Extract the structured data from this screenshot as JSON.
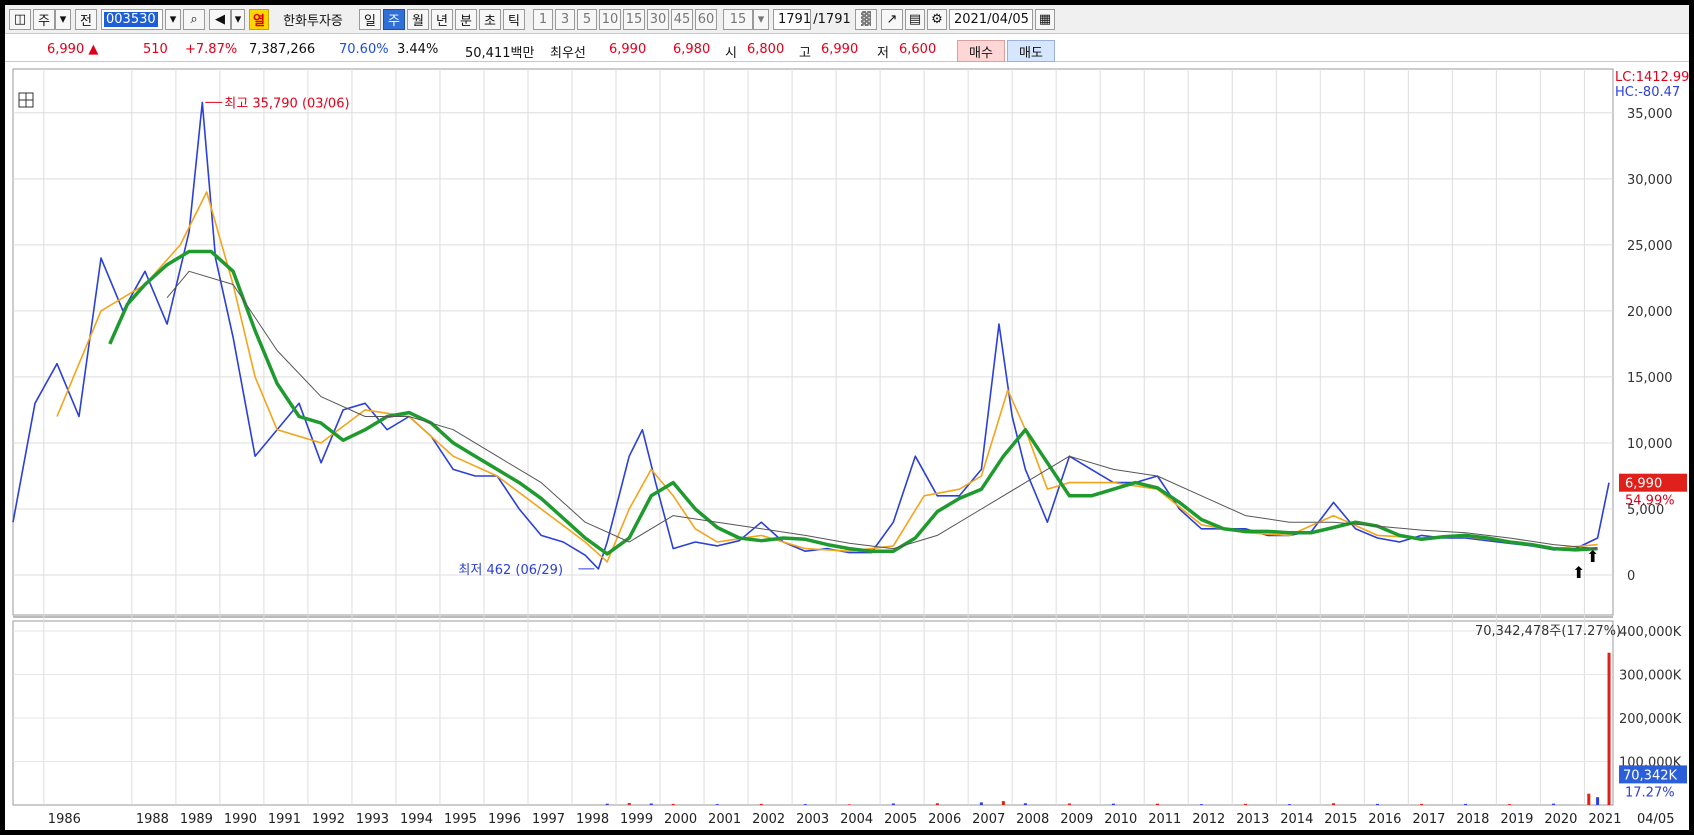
{
  "toolbar": {
    "type_label": "주",
    "prev_label": "전",
    "code_value": "003530",
    "broker_badge": "열",
    "broker_name": "한화투자증",
    "periods": [
      "일",
      "주",
      "월",
      "년",
      "분",
      "초",
      "틱"
    ],
    "active_period": "주",
    "intervals": [
      "1",
      "3",
      "5",
      "10",
      "15",
      "30",
      "45",
      "60"
    ],
    "interval_select": "15",
    "count": "1791",
    "total": "/1791",
    "date": "2021/04/05"
  },
  "quote": {
    "price": "6,990",
    "change": "510",
    "change_pct": "+7.87%",
    "volume": "7,387,266",
    "ratio1": "70.60%",
    "ratio2": "3.44%",
    "amount": "50,411백만",
    "pref_label": "최우선",
    "ask": "6,990",
    "bid": "6,980",
    "open_label": "시",
    "open": "6,800",
    "high_label": "고",
    "high": "6,990",
    "low_label": "저",
    "low": "6,600",
    "buy_label": "매수",
    "sell_label": "매도"
  },
  "chart_data": {
    "type": "line",
    "price_axis": {
      "ylim": [
        0,
        35790
      ],
      "ticks": [
        "0",
        "5,000",
        "10,000",
        "15,000",
        "20,000",
        "25,000",
        "30,000",
        "35,000"
      ],
      "tick_values": [
        0,
        5000,
        10000,
        15000,
        20000,
        25000,
        30000,
        35000
      ]
    },
    "volume_axis": {
      "ylim": [
        0,
        400000
      ],
      "ticks": [
        "100,000K",
        "200,000K",
        "300,000K",
        "400,000K"
      ],
      "tick_values": [
        100000,
        200000,
        300000,
        400000
      ]
    },
    "x_labels": [
      "1986",
      "1988",
      "1989",
      "1990",
      "1991",
      "1992",
      "1993",
      "1994",
      "1995",
      "1996",
      "1997",
      "1998",
      "1999",
      "2000",
      "2001",
      "2002",
      "2003",
      "2004",
      "2005",
      "2006",
      "2007",
      "2008",
      "2009",
      "2010",
      "2011",
      "2012",
      "2013",
      "2014",
      "2015",
      "2016",
      "2017",
      "2018",
      "2019",
      "2020",
      "2021"
    ],
    "x_end_label": "04/05",
    "lc_label": "LC:1412.99",
    "hc_label": "HC:-80.47",
    "last_price_label": "6,990",
    "last_pct_label": "54.99%",
    "volume_tag": "70,342K",
    "volume_pct_tag": "17.27%",
    "volume_note": "70,342,478주(17.27%)",
    "high_annotation": "최고 35,790 (03/06)",
    "low_annotation": "최저 462 (06/29)",
    "series": [
      {
        "color": "#2b3fd9",
        "x": [
          1985.0,
          1985.5,
          1986.0,
          1986.5,
          1987.0,
          1987.5,
          1988.0,
          1988.5,
          1989.0,
          1989.3,
          1989.6,
          1990.0,
          1990.5,
          1991.0,
          1991.5,
          1992.0,
          1992.5,
          1993.0,
          1993.5,
          1994.0,
          1994.5,
          1995.0,
          1995.5,
          1996.0,
          1996.5,
          1997.0,
          1997.5,
          1998.0,
          1998.3,
          1998.5,
          1999.0,
          1999.3,
          1999.6,
          2000.0,
          2000.5,
          2001.0,
          2001.5,
          2002.0,
          2002.5,
          2003.0,
          2003.5,
          2004.0,
          2004.5,
          2005.0,
          2005.5,
          2006.0,
          2006.5,
          2007.0,
          2007.4,
          2007.7,
          2008.0,
          2008.5,
          2009.0,
          2009.5,
          2010.0,
          2010.5,
          2011.0,
          2011.5,
          2012.0,
          2012.5,
          2013.0,
          2013.5,
          2014.0,
          2014.5,
          2015.0,
          2015.5,
          2016.0,
          2016.5,
          2017.0,
          2017.5,
          2018.0,
          2018.5,
          2019.0,
          2019.5,
          2020.0,
          2020.5,
          2021.0,
          2021.26
        ],
        "y": [
          4000,
          13000,
          16000,
          12000,
          24000,
          20000,
          23000,
          19000,
          26000,
          35790,
          24000,
          18000,
          9000,
          11000,
          13000,
          8500,
          12500,
          13000,
          11000,
          12000,
          10500,
          8000,
          7500,
          7500,
          5000,
          3000,
          2500,
          1500,
          462,
          2500,
          9000,
          11000,
          7000,
          2000,
          2500,
          2200,
          2600,
          4000,
          2500,
          1800,
          2000,
          1700,
          1700,
          4000,
          9000,
          6000,
          6000,
          8000,
          19000,
          12000,
          8000,
          4000,
          9000,
          8000,
          7000,
          7000,
          7500,
          5000,
          3500,
          3500,
          3500,
          3000,
          3000,
          3300,
          5500,
          3500,
          2800,
          2500,
          3000,
          2800,
          2800,
          2600,
          2400,
          2200,
          1900,
          2000,
          2800,
          6990
        ]
      },
      {
        "color": "#f2a51b",
        "x": [
          1986.0,
          1987.0,
          1988.0,
          1988.8,
          1989.4,
          1990.0,
          1990.5,
          1991.0,
          1992.0,
          1993.0,
          1994.0,
          1995.0,
          1996.0,
          1997.0,
          1998.0,
          1998.5,
          1999.0,
          1999.5,
          2000.0,
          2000.5,
          2001.0,
          2002.0,
          2003.0,
          2004.0,
          2005.0,
          2005.7,
          2006.5,
          2007.0,
          2007.6,
          2008.0,
          2008.5,
          2009.0,
          2010.0,
          2011.0,
          2012.0,
          2013.0,
          2014.0,
          2015.0,
          2016.0,
          2017.0,
          2018.0,
          2019.0,
          2020.0,
          2021.0
        ],
        "y": [
          12000,
          20000,
          22000,
          25000,
          29000,
          22000,
          15000,
          11000,
          10000,
          12500,
          12000,
          9000,
          7500,
          5000,
          2500,
          1000,
          5000,
          8000,
          6000,
          3500,
          2500,
          3000,
          2000,
          1800,
          2200,
          6000,
          6500,
          7500,
          14000,
          11000,
          6500,
          7000,
          7000,
          6500,
          3800,
          3200,
          3000,
          4500,
          3000,
          2800,
          2900,
          2500,
          2000,
          2300
        ]
      },
      {
        "color": "#1f9a2e",
        "x": [
          1987.2,
          1987.6,
          1988.0,
          1988.5,
          1989.0,
          1989.5,
          1990.0,
          1990.5,
          1991.0,
          1991.5,
          1992.0,
          1992.5,
          1993.0,
          1993.5,
          1994.0,
          1994.5,
          1995.0,
          1995.5,
          1996.0,
          1996.5,
          1997.0,
          1997.5,
          1998.0,
          1998.5,
          1999.0,
          1999.5,
          2000.0,
          2000.5,
          2001.0,
          2001.5,
          2002.0,
          2002.5,
          2003.0,
          2003.5,
          2004.0,
          2004.5,
          2005.0,
          2005.5,
          2006.0,
          2006.5,
          2007.0,
          2007.5,
          2008.0,
          2008.5,
          2009.0,
          2009.5,
          2010.0,
          2010.5,
          2011.0,
          2011.5,
          2012.0,
          2012.5,
          2013.0,
          2013.5,
          2014.0,
          2014.5,
          2015.0,
          2015.5,
          2016.0,
          2016.5,
          2017.0,
          2017.5,
          2018.0,
          2018.5,
          2019.0,
          2019.5,
          2020.0,
          2020.5,
          2021.0
        ],
        "y": [
          17500,
          20500,
          22000,
          23500,
          24500,
          24500,
          23000,
          18500,
          14500,
          12000,
          11500,
          10200,
          11000,
          12000,
          12300,
          11500,
          10000,
          9000,
          8000,
          7000,
          5800,
          4300,
          2800,
          1600,
          2800,
          6000,
          7000,
          5000,
          3600,
          2800,
          2600,
          2800,
          2700,
          2300,
          2000,
          1800,
          1800,
          2800,
          4800,
          5800,
          6500,
          9000,
          11000,
          8500,
          6000,
          6000,
          6500,
          7000,
          6600,
          5500,
          4200,
          3500,
          3300,
          3300,
          3200,
          3200,
          3600,
          4000,
          3700,
          3000,
          2700,
          2900,
          3000,
          2800,
          2500,
          2300,
          2000,
          1900,
          2000
        ]
      },
      {
        "color": "#555555",
        "x": [
          1988.5,
          1989.0,
          1990.0,
          1991.0,
          1992.0,
          1993.0,
          1994.0,
          1995.0,
          1996.0,
          1997.0,
          1998.0,
          1999.0,
          2000.0,
          2001.0,
          2002.0,
          2003.0,
          2004.0,
          2005.0,
          2006.0,
          2007.0,
          2008.0,
          2009.0,
          2010.0,
          2011.0,
          2012.0,
          2013.0,
          2014.0,
          2015.0,
          2016.0,
          2017.0,
          2018.0,
          2019.0,
          2020.0,
          2021.0
        ],
        "y": [
          21000,
          23000,
          22000,
          17000,
          13500,
          12000,
          12000,
          11000,
          9000,
          7000,
          4000,
          2500,
          4500,
          4000,
          3500,
          3000,
          2400,
          2000,
          3000,
          5000,
          7000,
          9000,
          8000,
          7500,
          6000,
          4500,
          4000,
          4000,
          3700,
          3400,
          3200,
          2800,
          2300,
          2000
        ]
      }
    ],
    "volume": {
      "x": [
        1998.5,
        1999.0,
        1999.5,
        2000.0,
        2001.0,
        2002.0,
        2003.0,
        2004.0,
        2005.0,
        2006.0,
        2007.0,
        2007.5,
        2008.0,
        2009.0,
        2010.0,
        2011.0,
        2012.0,
        2013.0,
        2014.0,
        2015.0,
        2016.0,
        2017.0,
        2018.0,
        2019.0,
        2020.0,
        2020.8,
        2021.0,
        2021.26
      ],
      "values": [
        3000,
        4500,
        3500,
        2500,
        2000,
        2500,
        2000,
        1500,
        3500,
        4000,
        6000,
        9000,
        4000,
        3500,
        3000,
        3000,
        2000,
        2500,
        2000,
        4000,
        2500,
        2500,
        2500,
        2000,
        3000,
        26000,
        18000,
        350000
      ]
    }
  }
}
